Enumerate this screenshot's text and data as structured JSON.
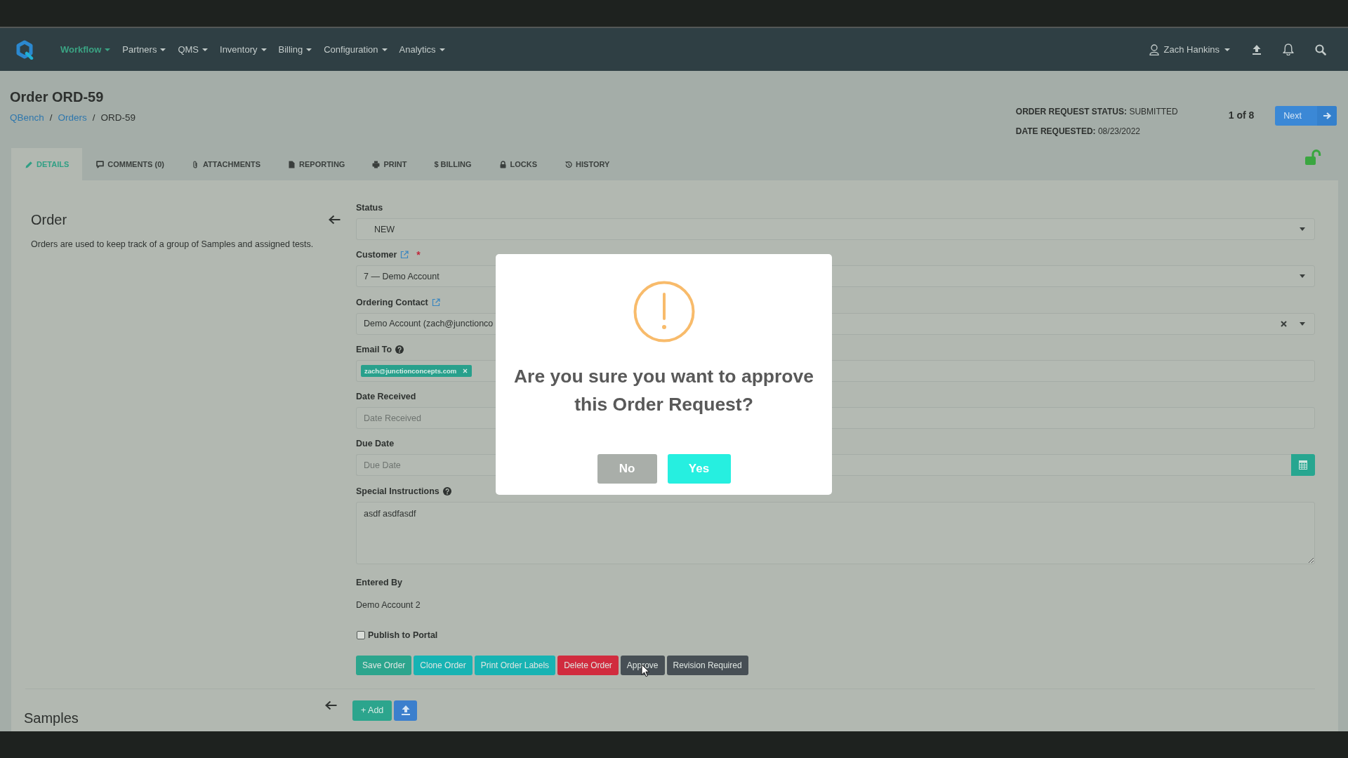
{
  "nav": {
    "items": [
      {
        "label": "Workflow",
        "selected": true
      },
      {
        "label": "Partners",
        "selected": false
      },
      {
        "label": "QMS",
        "selected": false
      },
      {
        "label": "Inventory",
        "selected": false
      },
      {
        "label": "Billing",
        "selected": false
      },
      {
        "label": "Configuration",
        "selected": false
      },
      {
        "label": "Analytics",
        "selected": false
      }
    ],
    "user": "Zach Hankins"
  },
  "header": {
    "title": "Order ORD-59",
    "breadcrumb": [
      {
        "label": "QBench",
        "kind": "link"
      },
      {
        "label": "/",
        "kind": "separator"
      },
      {
        "label": "Orders",
        "kind": "link"
      },
      {
        "label": "/",
        "kind": "separator"
      },
      {
        "label": "ORD-59",
        "kind": "current"
      }
    ],
    "request_status": "**ORDER REQUEST STATUS:** SUBMITTED",
    "date_requested": "**DATE REQUESTED:** 08/23/2022",
    "pager": "1 of 8",
    "next_button": "Next"
  },
  "tabs": [
    {
      "label": "DETAILS",
      "selected": true
    },
    {
      "label": "COMMENTS (0)",
      "selected": false
    },
    {
      "label": "ATTACHMENTS",
      "selected": false
    },
    {
      "label": "REPORTING",
      "selected": false
    },
    {
      "label": "PRINT",
      "selected": false
    },
    {
      "label": "$ BILLING",
      "selected": false
    },
    {
      "label": "LOCKS",
      "selected": false
    },
    {
      "label": "HISTORY",
      "selected": false
    }
  ],
  "order_section": {
    "heading": "Order",
    "description": "Orders are used to keep track of a group of Samples and assigned tests."
  },
  "form": {
    "fields": [
      {
        "kind": "dropdown",
        "label": "Status",
        "link": false,
        "help": false,
        "value": "NEW",
        "clearable": false
      },
      {
        "kind": "combobox",
        "label": "Customer",
        "link": true,
        "help": false,
        "required_mark": "*",
        "value": "7 — Demo Account",
        "clearable": false
      },
      {
        "kind": "combobox",
        "label": "Ordering Contact",
        "link": true,
        "help": false,
        "value": "Demo Account (zach@junctionco",
        "clearable": true
      },
      {
        "kind": "tags",
        "label": "Email To",
        "link": false,
        "help": true,
        "tags": [
          "zach@junctionconcepts.com"
        ]
      },
      {
        "kind": "input",
        "label": "Date Received",
        "link": false,
        "help": false,
        "placeholder": "Date Received"
      },
      {
        "kind": "date",
        "label": "Due Date",
        "link": false,
        "help": false,
        "placeholder": "Due Date"
      },
      {
        "kind": "textarea",
        "label": "Special Instructions",
        "link": false,
        "help": true,
        "value": "asdf asdfasdf"
      },
      {
        "kind": "static",
        "label": "Entered By",
        "value": "Demo Account 2"
      },
      {
        "kind": "checkbox",
        "label": "Publish to Portal",
        "checked": false
      }
    ],
    "actions": [
      {
        "label": "Save Order",
        "color": "#2ca58d"
      },
      {
        "label": "Clone Order",
        "color": "#17b3b3"
      },
      {
        "label": "Print Order Labels",
        "color": "#17b3b3"
      },
      {
        "label": "Delete Order",
        "color": "#d12b3e"
      },
      {
        "label": "Approve",
        "color": "#474f55"
      },
      {
        "label": "Revision Required",
        "color": "#474f55"
      }
    ]
  },
  "samples_section": {
    "heading": "Samples",
    "add_button": "+ Add"
  },
  "dialog": {
    "message": "Are you sure you want to approve this Order Request?",
    "buttons": [
      {
        "label": "No",
        "kind": "cancel"
      },
      {
        "label": "Yes",
        "kind": "confirm"
      }
    ]
  }
}
